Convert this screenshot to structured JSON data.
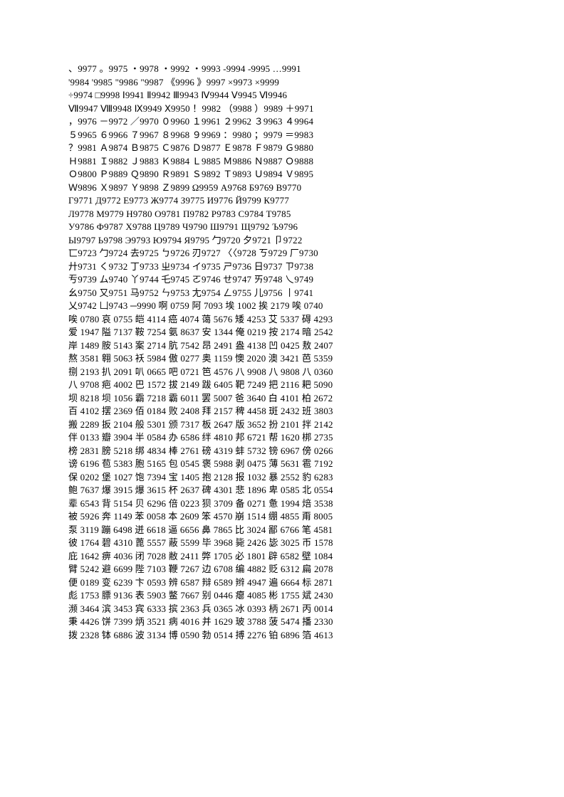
{
  "lines": [
    "、9977 。9975 ・9978 ・9992 ・9993 -9994 -9995 …9991",
    "'9984 '9985 \"9986 \"9987 《9996 》9997 ×9973 ×9999",
    "÷9974 □9998 Ⅰ9941 Ⅱ9942 Ⅲ9943 Ⅳ9944 Ⅴ9945 Ⅵ9946",
    "Ⅶ9947 Ⅷ9948 Ⅸ9949 Ⅹ9950 ！9982 （9988 ）9989 ＋9971",
    "，9976 －9972 ／9970 ０9960 １9961 ２9962 ３9963 ４9964",
    "５9965 ６9966 ７9967 ８9968 ９9969 ：9980 ；9979 ＝9983",
    "？9981 Ａ9874 Ｂ9875 Ｃ9876 Ｄ9877 Ｅ9878 Ｆ9879 Ｇ9880",
    "Ｈ9881 Ｉ9882 Ｊ9883 Ｋ9884 Ｌ9885 Ｍ9886 Ｎ9887 Ｏ9888",
    "Ｏ9800 Ｐ9889 Ｑ9890 Ｒ9891 Ｓ9892 Ｔ9893 Ｕ9894 Ｖ9895",
    "Ｗ9896 Ｘ9897 Ｙ9898 Ｚ9899 Ω9959 А9768 Б9769 В9770",
    "Г9771 Д9772 Е9773 Ж9774 З9775 И9776 Й9799 К9777",
    "Л9778 М9779 Н9780 О9781 П9782 Р9783 С9784 Т9785",
    "У9786 Ф9787 Х9788 Ц9789 Ч9790 Ш9791 Щ9792 Ъ9796",
    "Ы9797 Ь9798 Э9793 Ю9794 Я9795 勹9720 夕9721 卩9722",
    "匸9723 勹9724 去9725 ㄅ9726 刃9727 〈〈9728 ㄎ9729 厂9730",
    "廾9731 く9732 丁9733 ㄓ9734 イ9735 ㄕ9736 日9737 ㄗ9738",
    "亐9739 ム9740 丫9744 乇9745 ㄛ9746 せ9747 ㄞ9748 乀9749",
    "幺9750 又9751 马9752 ㄣ9753 尢9754 ㄥ9755 儿9756 丨9741",
    "乂9742 凵9743 ─9990  啊 0759  阿 7093  埃 1002  挨 2179  唉 0740",
    "唉 0780  哀 0755  皑 4114  癌 4074  蔼 5676  矮 4253  艾 5337  碍 4293",
    "爱 1947  隘 7137  鞍 7254  氨 8637  安 1344  俺 0219  按 2174  暗 2542",
    "岸 1489  胺 5143  案 2714  肮 7542  昂 2491  盎 4138  凹 0425  敖 2407",
    "熬 3581  翱 5063  袄 5984  傲 0277  奥 1159  懊 2020  澳 3421  芭 5359",
    "捌 2193  扒 2091  叭 0665  吧 0721  笆 4576  八 9908  八 9808  八 0360",
    "八 9708  疤 4002  巴 1572  拔 2149  跋 6405  靶 7249  把 2116  耙 5090",
    "坝 8218  坝 1056  霸 7218  霸 6011  罢 5007  爸 3640  白 4101  柏 2672",
    "百 4102  摆 2369  佰 0184  败 2408  拜 2157  稗 4458  斑 2432  班 3803",
    "搬 2289  扳 2104  般 5301  颁 7317  板 2647  版 3652  扮 2101  拌 2142",
    "伴 0133  瓣 3904  半 0584  办 6586  绊 4810  邦 6721  帮 1620  梆 2735",
    "榜 2831  膀 5218  绑 4834  棒 2761  磅 4319  蚌 5732  镑 6967  傍 0266",
    "谤 6196  苞 5383  胞 5165  包 0545  褒 5988  剥 0475  薄 5631  雹 7192",
    "保 0202  堡 1027  饱 7394  宝 1405  抱 2128  报 1032  暴 2552  豹 6283",
    "鲍 7637  爆 3915  爆 3615  杯 2637  碑 4301  悲 1896  卑 0585  北 0554",
    "辈 6543  背 5154  贝 6296  倍 0223  狈 3709  备 0271  惫 1994  焙 3538",
    "被 5926  奔 1149  苯 0058  本 2609  笨 4570  崩 1514  绷 4855  甭 8005",
    "泵 3119  蹦 6498  迸 6618  逼 6656  鼻 7865  比 3024  鄙 6766  笔 4581",
    "彼 1764  碧 4310  蓖 5557  蔽 5599  毕 3968  毙 2426  毖 3025  币 1578",
    "庇 1642  痹 4036  闭 7028  敝 2411  弊 1705  必 1801  辟 6582  壁 1084",
    "臂 5242  避 6699  陛 7103  鞭 7267  边 6708  编 4882  贬 6312  扁 2078",
    "便 0189  变 6239  卞 0593  辨 6587  辩 6589  辫 4947  遍 6664  标 2871",
    "彪 1753  膘 9136  表 5903  鳖 7667  别 0446  瘪 4085  彬 1755  斌 2430",
    "濒 3464  滨 3453  宾 6333  摈 2363  兵 0365  冰 0393  柄 2671  丙 0014",
    "秉 4426  饼 7399  炳 3521  病 4016  并 1629  玻 3788  菠 5474  播 2330",
    "拨 2328  钵 6886  波 3134  博 0590  勃 0514  搏 2276  铂 6896  箔 4613"
  ]
}
